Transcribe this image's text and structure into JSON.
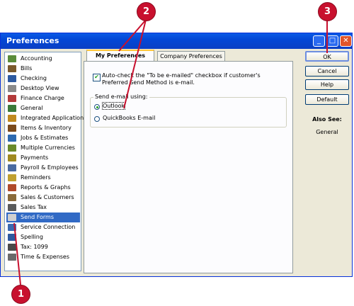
{
  "window": {
    "title": "Preferences"
  },
  "sidebar": {
    "items": [
      {
        "label": "Accounting",
        "icon": "accounting-icon",
        "color": "#5b8c3a"
      },
      {
        "label": "Bills",
        "icon": "bills-icon",
        "color": "#7a5a2c"
      },
      {
        "label": "Checking",
        "icon": "checking-icon",
        "color": "#2d5aa0"
      },
      {
        "label": "Desktop View",
        "icon": "desktop-view-icon",
        "color": "#8a8a8a"
      },
      {
        "label": "Finance Charge",
        "icon": "finance-charge-icon",
        "color": "#b33a3a"
      },
      {
        "label": "General",
        "icon": "general-icon",
        "color": "#3a7a3a"
      },
      {
        "label": "Integrated Applications",
        "icon": "integrated-apps-icon",
        "color": "#c08a20"
      },
      {
        "label": "Items & Inventory",
        "icon": "items-inventory-icon",
        "color": "#7a4a1c"
      },
      {
        "label": "Jobs & Estimates",
        "icon": "jobs-estimates-icon",
        "color": "#2d6ab0"
      },
      {
        "label": "Multiple Currencies",
        "icon": "multiple-currencies-icon",
        "color": "#6a8a2a"
      },
      {
        "label": "Payments",
        "icon": "payments-icon",
        "color": "#a08a20"
      },
      {
        "label": "Payroll & Employees",
        "icon": "payroll-icon",
        "color": "#4a6aa0"
      },
      {
        "label": "Reminders",
        "icon": "reminders-icon",
        "color": "#c0a030"
      },
      {
        "label": "Reports & Graphs",
        "icon": "reports-graphs-icon",
        "color": "#b04a2a"
      },
      {
        "label": "Sales & Customers",
        "icon": "sales-customers-icon",
        "color": "#8a6a3a"
      },
      {
        "label": "Sales Tax",
        "icon": "sales-tax-icon",
        "color": "#5a5a5a"
      },
      {
        "label": "Send Forms",
        "icon": "send-forms-icon",
        "color": "#d0d0d0"
      },
      {
        "label": "Service Connection",
        "icon": "service-connection-icon",
        "color": "#3a6ab0"
      },
      {
        "label": "Spelling",
        "icon": "spelling-icon",
        "color": "#2d5aa0"
      },
      {
        "label": "Tax: 1099",
        "icon": "tax-1099-icon",
        "color": "#4a4a4a"
      },
      {
        "label": "Time & Expenses",
        "icon": "time-expenses-icon",
        "color": "#6a6a6a"
      }
    ],
    "selected": "Send Forms"
  },
  "tabs": [
    {
      "label": "My Preferences",
      "active": true
    },
    {
      "label": "Company Preferences",
      "active": false
    }
  ],
  "panel": {
    "checkbox_label": "Auto-check the \"To be e-mailed\" checkbox if customer's Preferred Send Method is e-mail.",
    "checkbox_checked": true,
    "group_title": "Send e-mail using:",
    "options": [
      {
        "label": "Outlook",
        "selected": true
      },
      {
        "label": "QuickBooks E-mail",
        "selected": false
      }
    ]
  },
  "buttons": {
    "ok": "OK",
    "cancel": "Cancel",
    "help": "Help",
    "default": "Default"
  },
  "also_see": {
    "title": "Also See:",
    "link": "General"
  },
  "callouts": [
    "1",
    "2",
    "3"
  ],
  "colors": {
    "title_bar": "#0a4fd6",
    "selection": "#316ac5",
    "callout": "#c8102e",
    "active_tab_accent": "#ffc83c"
  }
}
